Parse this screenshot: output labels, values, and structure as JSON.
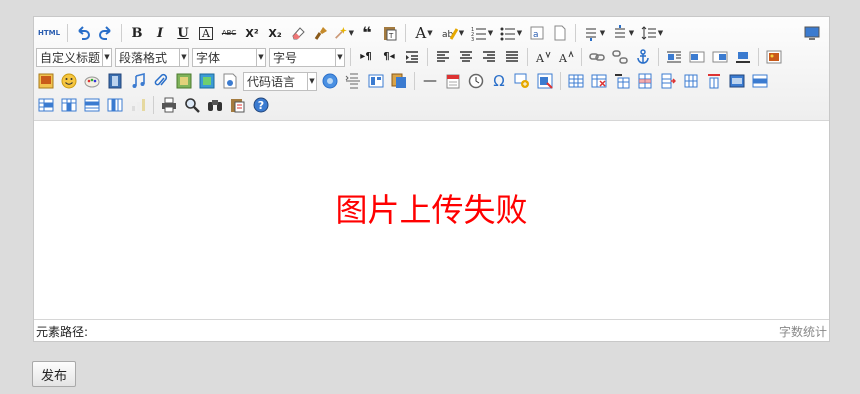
{
  "toolbar": {
    "html_label": "HTML",
    "combos": {
      "custom_title": "自定义标题",
      "paragraph_format": "段落格式",
      "font_family": "字体",
      "font_size": "字号",
      "code_language": "代码语言"
    },
    "glyphs": {
      "bold": "B",
      "italic": "I",
      "underline": "U",
      "font_border": "A",
      "strikethrough": "ABC",
      "superscript": "X²",
      "subscript": "X₂",
      "blockquote": "❝",
      "forecolor": "A",
      "omega": "Ω",
      "horizontal_rule": "—",
      "rtl": "¶◂",
      "ltr": "▸¶",
      "help": "?"
    },
    "icons": [
      "undo-icon",
      "redo-icon",
      "eraser-icon",
      "format-brush-icon",
      "magic-wand-icon",
      "paste-plain-icon",
      "highlight-icon",
      "ordered-list-icon",
      "unordered-list-icon",
      "select-all-icon",
      "clear-doc-icon",
      "link-icon",
      "unlink-icon",
      "anchor-icon",
      "image-icon",
      "emotion-icon",
      "scrawl-icon",
      "video-icon",
      "music-icon",
      "attachment-icon",
      "map-icon",
      "gmap-icon",
      "insert-frame-icon",
      "code-icon",
      "page-break-icon",
      "template-icon",
      "background-icon",
      "date-icon",
      "time-icon",
      "snapscreen-icon",
      "word-image-icon",
      "table-icon",
      "print-icon",
      "preview-icon",
      "search-replace-icon",
      "drafts-icon",
      "fullscreen-icon"
    ]
  },
  "content": {
    "image_message": "图片上传失败"
  },
  "status": {
    "element_path_label": "元素路径:",
    "word_count_label": "字数统计"
  },
  "actions": {
    "publish_label": "发布"
  },
  "colors": {
    "error_text": "#ff0000",
    "page_background": "#dcdcdc"
  }
}
